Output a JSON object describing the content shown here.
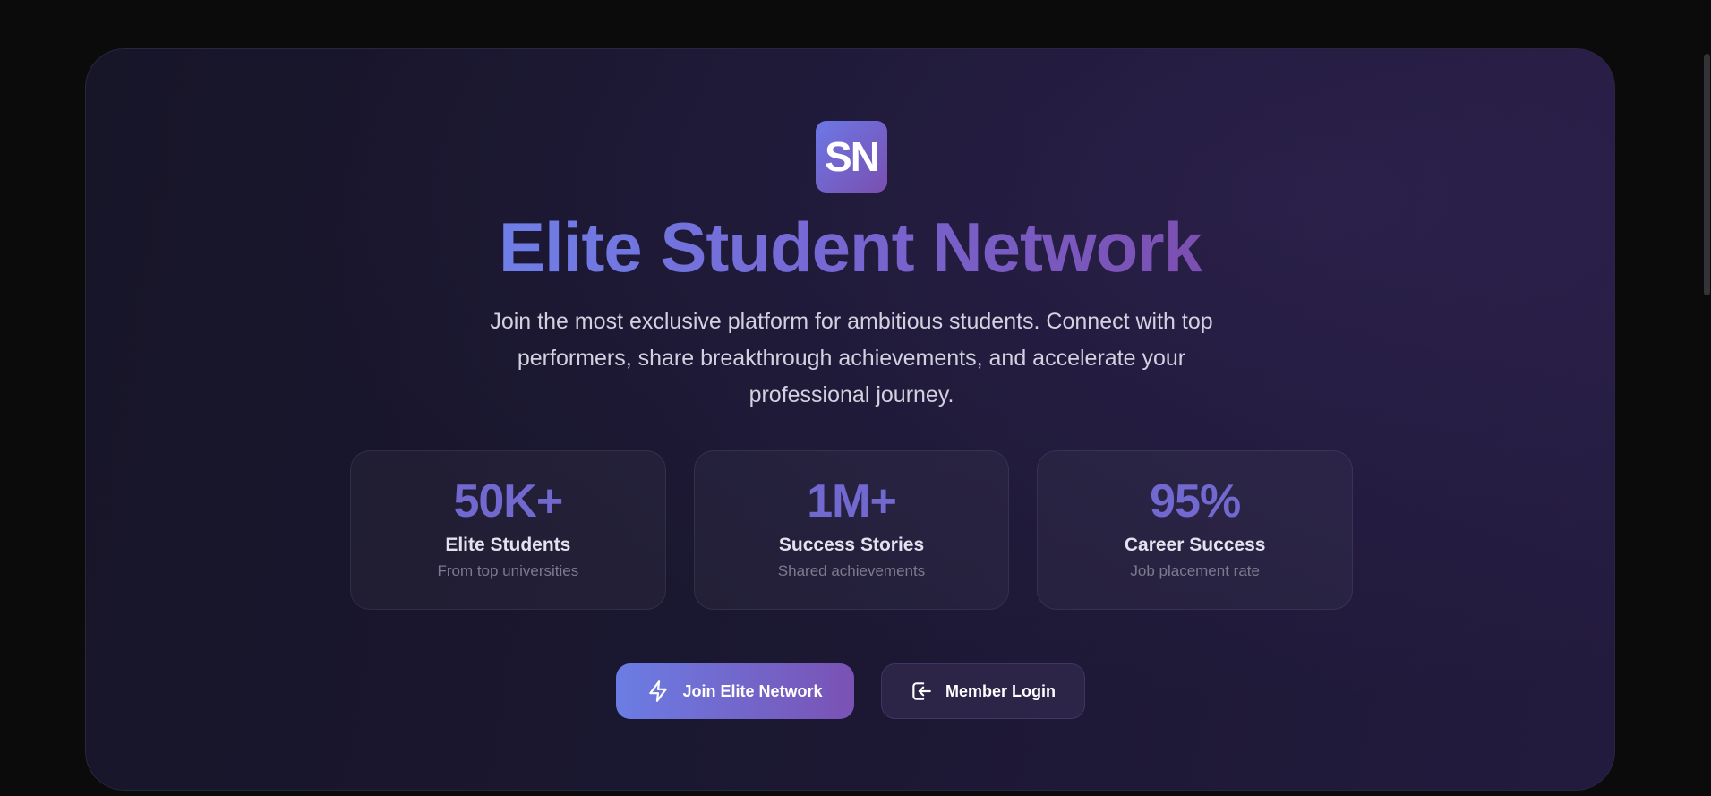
{
  "logo": {
    "text": "SN"
  },
  "hero": {
    "title": "Elite Student Network",
    "subtitle": "Join the most exclusive platform for ambitious students. Connect with top performers, share breakthrough achievements, and accelerate your professional journey."
  },
  "stats": [
    {
      "value": "50K+",
      "label": "Elite Students",
      "description": "From top universities"
    },
    {
      "value": "1M+",
      "label": "Success Stories",
      "description": "Shared achievements"
    },
    {
      "value": "95%",
      "label": "Career Success",
      "description": "Job placement rate"
    }
  ],
  "actions": {
    "join_label": "Join Elite Network",
    "join_icon": "lightning-icon",
    "login_label": "Member Login",
    "login_icon": "login-icon"
  },
  "colors": {
    "accent_start": "#6b7de4",
    "accent_end": "#7a52b4",
    "stat_value": "#7168d0",
    "background": "#171528"
  }
}
